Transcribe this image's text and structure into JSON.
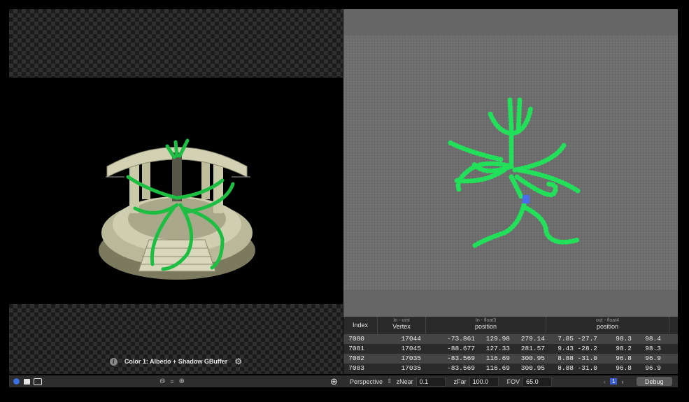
{
  "caption": {
    "info_icon": "info-icon",
    "label": "Color 1: Albedo + Shadow GBuffer",
    "settings_icon": "gear-icon"
  },
  "table": {
    "columns": [
      {
        "sub": "",
        "main": "Index"
      },
      {
        "sub": "In - uint",
        "main": "Vertex"
      },
      {
        "sub": "In - float3",
        "main": "position"
      },
      {
        "sub": "out - float4",
        "main": "position"
      }
    ],
    "rows": [
      [
        "7080",
        "17044",
        "-73.861",
        "129.98",
        "279.14",
        "7.85",
        "-27.7",
        "98.3",
        "98.4"
      ],
      [
        "7081",
        "17045",
        "-88.677",
        "127.33",
        "281.57",
        "9.43",
        "-28.2",
        "98.2",
        "98.3"
      ],
      [
        "7082",
        "17035",
        "-83.569",
        "116.69",
        "300.95",
        "8.88",
        "-31.0",
        "96.8",
        "96.9"
      ],
      [
        "7083",
        "17035",
        "-83.569",
        "116.69",
        "300.95",
        "8.88",
        "-31.0",
        "96.8",
        "96.9"
      ]
    ]
  },
  "bottom": {
    "projection_label": "Perspective",
    "znear_label": "zNear",
    "znear_value": "0.1",
    "zfar_label": "zFar",
    "zfar_value": "100.0",
    "fov_label": "FOV",
    "fov_value": "65.0",
    "page_indicator": "1",
    "debug_label": "Debug"
  },
  "colors": {
    "mesh_green": "#22e05a",
    "temple_stone": "#c8c7a6",
    "selected_vertex": "#4a6cf0"
  }
}
